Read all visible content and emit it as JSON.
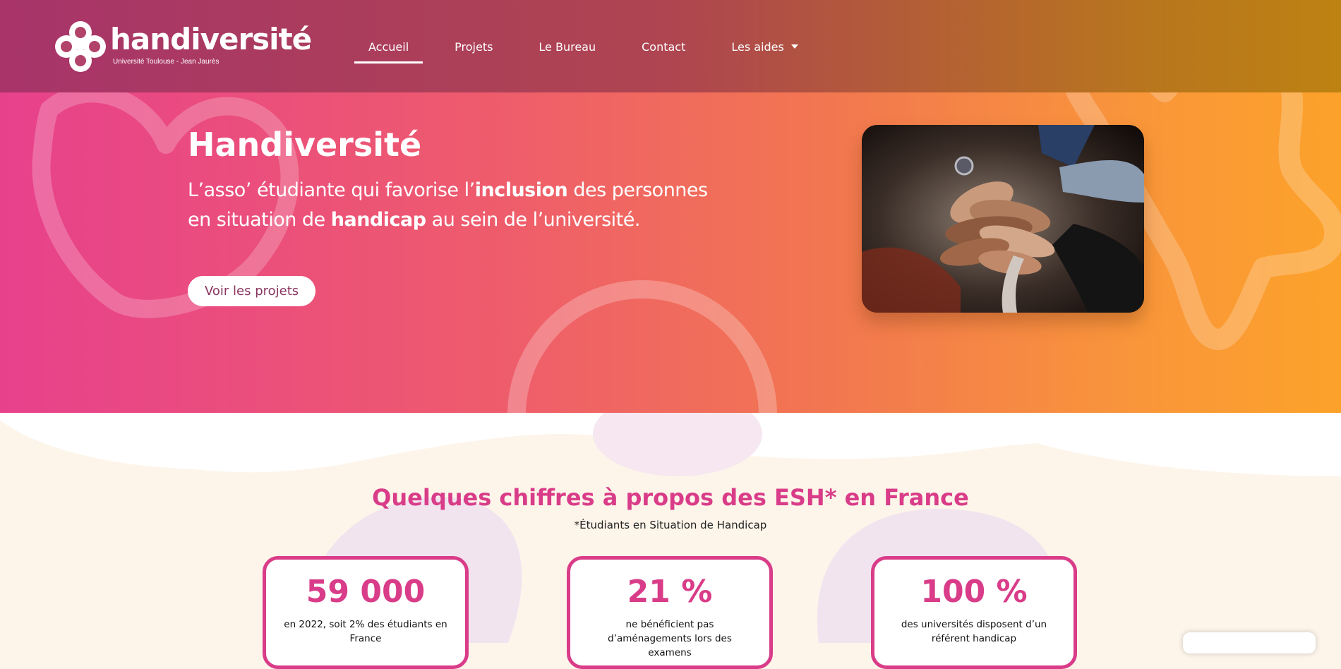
{
  "colors": {
    "accent_pink": "#d93c88",
    "hero_gradient_start": "#e7418c",
    "hero_gradient_end": "#fca22a",
    "header_start": "#a8346a",
    "header_end": "#bd8212",
    "cream_background": "#fdf5ea"
  },
  "header": {
    "logo": {
      "name": "handiversité",
      "subtitle": "Université Toulouse - Jean Jaurès",
      "icon": "flower-heart-logo-icon"
    },
    "nav": [
      {
        "label": "Accueil",
        "active": true
      },
      {
        "label": "Projets"
      },
      {
        "label": "Le Bureau"
      },
      {
        "label": "Contact"
      },
      {
        "label": "Les aides",
        "icon": "caret-down-icon"
      }
    ]
  },
  "hero": {
    "title": "Handiversité",
    "tagline": {
      "part1": "L’asso’ étudiante qui favorise l’",
      "bold1": "inclusion",
      "part2": " des personnes en situation de ",
      "bold2": "handicap",
      "part3": " au sein de l’université."
    },
    "button_label": "Voir les projets",
    "image": "stacked-hands-photo"
  },
  "stats": {
    "title": "Quelques chiffres à propos des ESH* en France",
    "subtitle": "*Étudiants en Situation de Handicap",
    "cards": [
      {
        "value": "59 000",
        "description": "en 2022, soit 2% des étudiants en France"
      },
      {
        "value": "21 %",
        "description": "ne bénéficient pas d’aménagements lors des examens"
      },
      {
        "value": "100 %",
        "description": "des universités disposent d’un référent handicap"
      }
    ]
  }
}
